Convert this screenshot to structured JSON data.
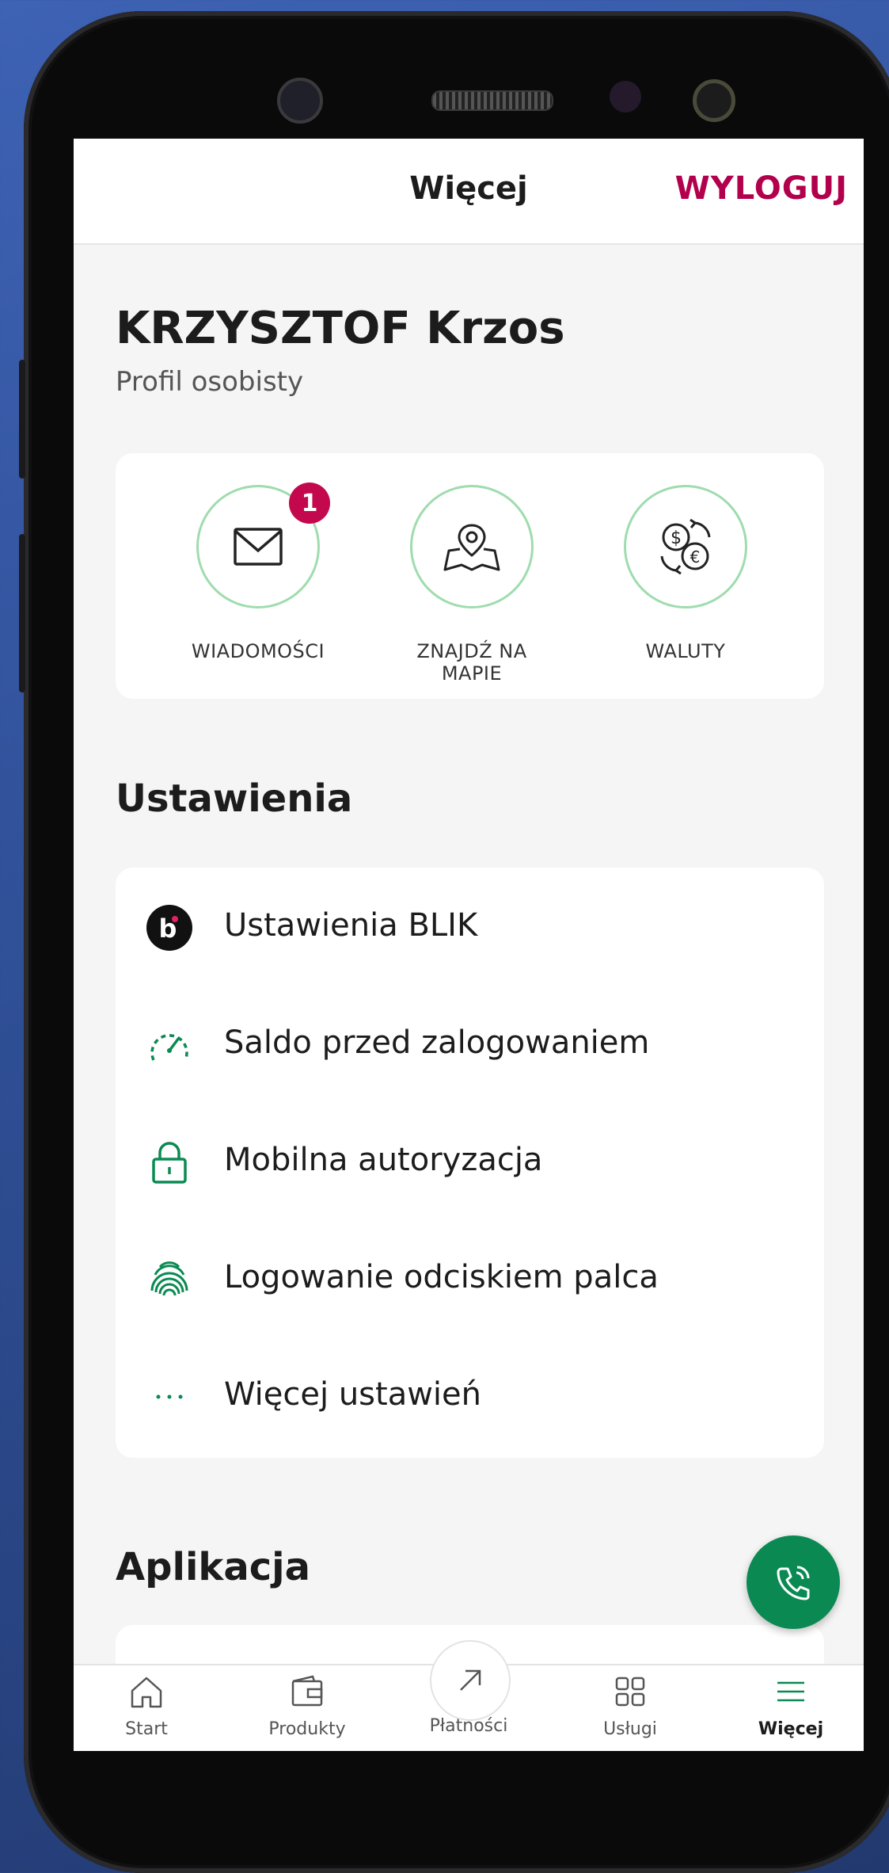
{
  "header": {
    "title": "Więcej",
    "logout_label": "WYLOGUJ"
  },
  "profile": {
    "name": "KRZYSZTOF Krzos",
    "type": "Profil osobisty"
  },
  "quick_actions": [
    {
      "label": "WIADOMOŚCI",
      "icon": "envelope-icon",
      "badge": "1"
    },
    {
      "label": "ZNAJDŹ NA MAPIE",
      "icon": "map-pin-icon"
    },
    {
      "label": "WALUTY",
      "icon": "currency-exchange-icon"
    }
  ],
  "settings": {
    "title": "Ustawienia",
    "items": [
      {
        "label": "Ustawienia BLIK",
        "icon": "blik-icon"
      },
      {
        "label": "Saldo przed zalogowaniem",
        "icon": "speedometer-icon"
      },
      {
        "label": "Mobilna autoryzacja",
        "icon": "lock-icon"
      },
      {
        "label": "Logowanie odciskiem palca",
        "icon": "fingerprint-icon"
      },
      {
        "label": "Więcej ustawień",
        "icon": "more-dots-icon"
      }
    ]
  },
  "application": {
    "title": "Aplikacja"
  },
  "bottom_nav": [
    {
      "label": "Start",
      "icon": "home-icon"
    },
    {
      "label": "Produkty",
      "icon": "wallet-icon"
    },
    {
      "label": "Płatności",
      "icon": "arrow-up-right-icon"
    },
    {
      "label": "Usługi",
      "icon": "grid-icon"
    },
    {
      "label": "Więcej",
      "icon": "menu-icon",
      "active": true
    }
  ],
  "colors": {
    "accent": "#b3004d",
    "green": "#0a8a52",
    "badge": "#c4084d",
    "ring": "#9fdcae"
  }
}
